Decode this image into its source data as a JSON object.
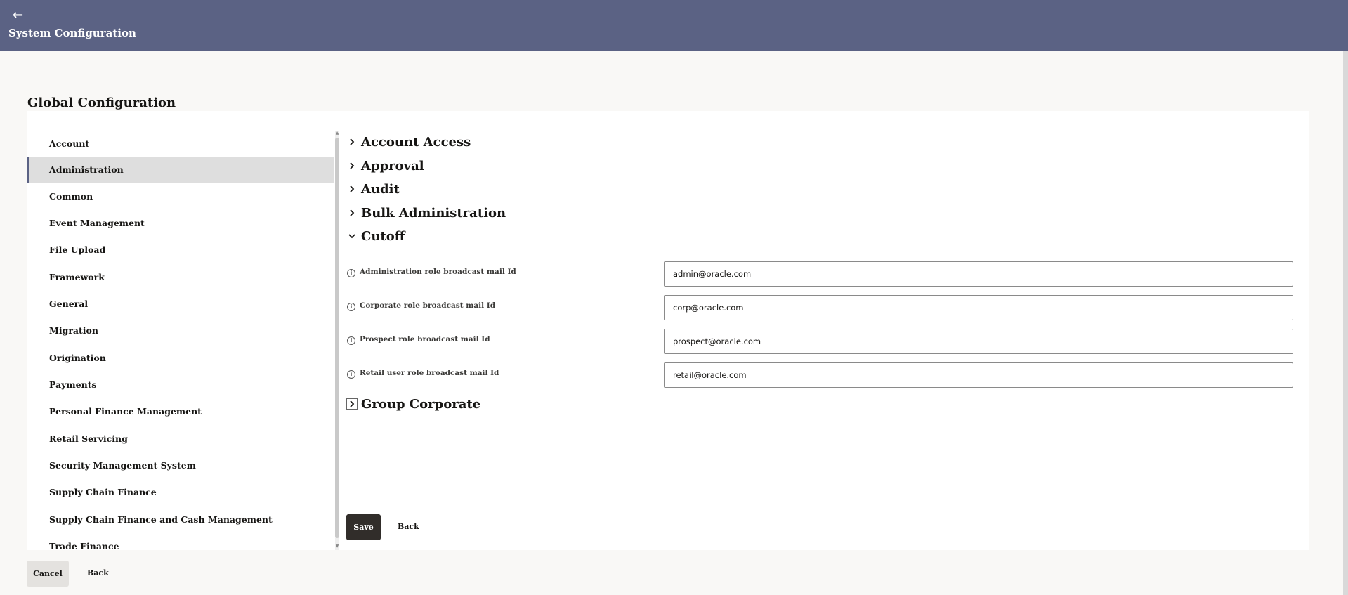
{
  "header": {
    "back_icon": "←",
    "title": "System Configuration",
    "color": "#5b6284"
  },
  "page": {
    "title": "Global Configuration"
  },
  "sidebar": {
    "items": [
      {
        "label": "Account",
        "active": false
      },
      {
        "label": "Administration",
        "active": true
      },
      {
        "label": "Common",
        "active": false
      },
      {
        "label": "Event Management",
        "active": false
      },
      {
        "label": "File Upload",
        "active": false
      },
      {
        "label": "Framework",
        "active": false
      },
      {
        "label": "General",
        "active": false
      },
      {
        "label": "Migration",
        "active": false
      },
      {
        "label": "Origination",
        "active": false
      },
      {
        "label": "Payments",
        "active": false
      },
      {
        "label": "Personal Finance Management",
        "active": false
      },
      {
        "label": "Retail Servicing",
        "active": false
      },
      {
        "label": "Security Management System",
        "active": false
      },
      {
        "label": "Supply Chain Finance",
        "active": false
      },
      {
        "label": "Supply Chain Finance and Cash Management",
        "active": false
      },
      {
        "label": "Trade Finance",
        "active": false
      }
    ]
  },
  "sections": [
    {
      "label": "Account Access",
      "expanded": false
    },
    {
      "label": "Approval",
      "expanded": false
    },
    {
      "label": "Audit",
      "expanded": false
    },
    {
      "label": "Bulk Administration",
      "expanded": false
    },
    {
      "label": "Cutoff",
      "expanded": true
    },
    {
      "label": "Group Corporate",
      "expanded": false
    }
  ],
  "fields": [
    {
      "label": "Administration role broadcast mail Id",
      "value": "admin@oracle.com"
    },
    {
      "label": "Corporate role broadcast mail Id",
      "value": "corp@oracle.com"
    },
    {
      "label": "Prospect role broadcast mail Id",
      "value": "prospect@oracle.com"
    },
    {
      "label": "Retail user role broadcast mail Id",
      "value": "retail@oracle.com"
    }
  ],
  "actions": {
    "save": "Save",
    "back": "Back",
    "cancel": "Cancel",
    "back_outer": "Back"
  }
}
